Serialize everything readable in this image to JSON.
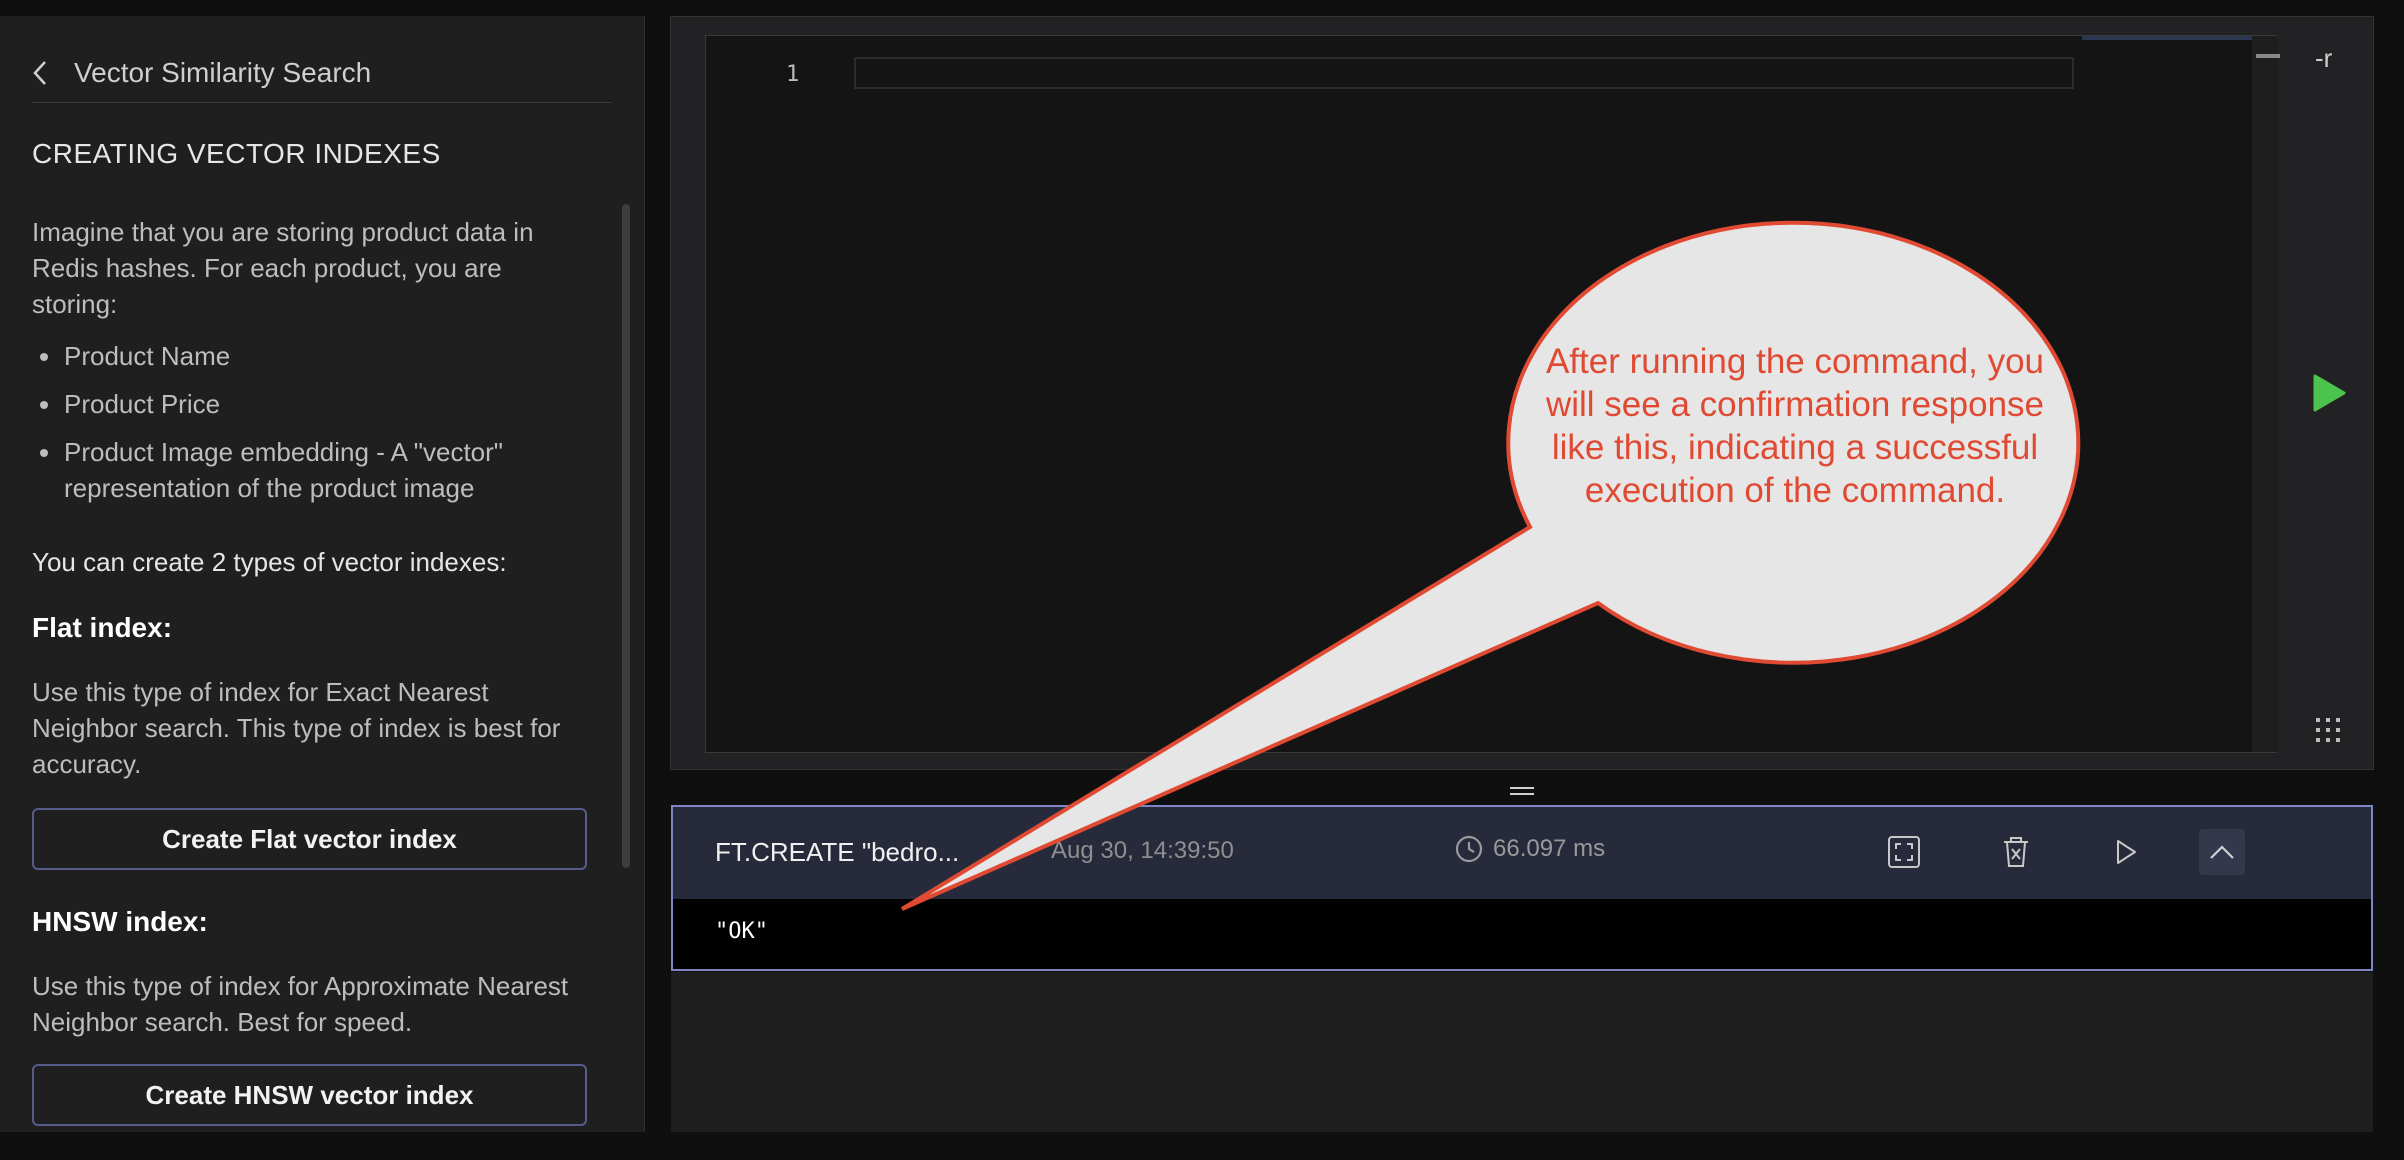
{
  "tutorial": {
    "title": "Vector Similarity Search",
    "section_heading": "CREATING VECTOR INDEXES",
    "intro": "Imagine that you are storing product data in Redis hashes. For each product, you are storing:",
    "bullets": [
      "Product Name",
      "Product Price",
      "Product Image embedding - A \"vector\" representation of the product image"
    ],
    "types_line": "You can create 2 types of vector indexes:",
    "flat": {
      "heading": "Flat index:",
      "desc": "Use this type of index for Exact Nearest Neighbor search. This type of index is best for accuracy.",
      "button": "Create Flat vector index"
    },
    "hnsw": {
      "heading": "HNSW index:",
      "desc": "Use this type of index for Approximate Nearest Neighbor search. Best for speed.",
      "button": "Create HNSW vector index"
    }
  },
  "editor": {
    "line_number": "1",
    "side_label": "-r",
    "run_icon": "play-triangle-green",
    "grid_icon": "dots-grid"
  },
  "result": {
    "command": "FT.CREATE \"bedro...",
    "timestamp": "Aug 30, 14:39:50",
    "exec_time": "66.097 ms",
    "output": "\"OK\"",
    "actions": [
      "fullscreen-icon",
      "delete-icon",
      "rerun-icon",
      "collapse-icon"
    ]
  },
  "annotation": {
    "text": "After running the command, you will see a confirmation response like this, indicating a successful execution of the command.",
    "color": "#e04a33"
  }
}
